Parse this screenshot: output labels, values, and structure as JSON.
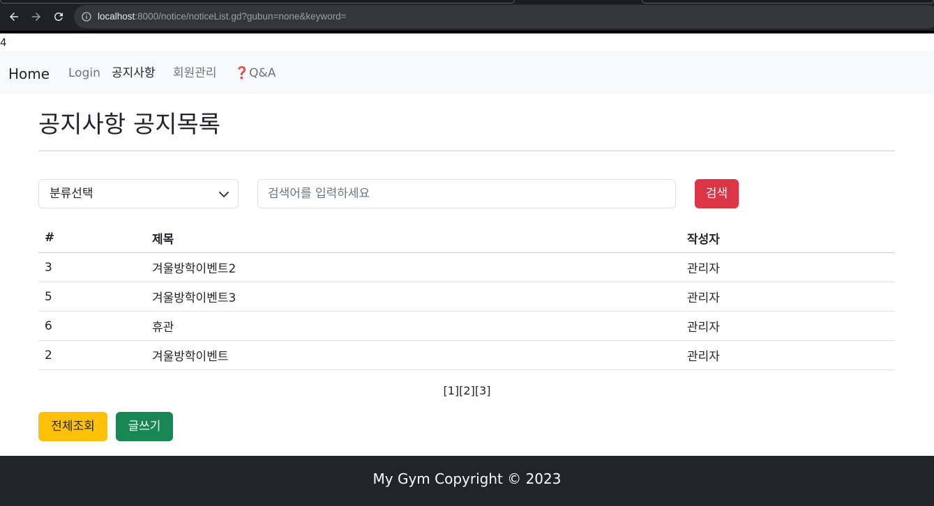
{
  "browser": {
    "url_host": "localhost",
    "url_rest": ":8000/notice/noticeList.gd?gubun=none&keyword=",
    "icons": {
      "back": "arrow-left-icon",
      "forward": "arrow-right-icon",
      "reload": "reload-icon",
      "info": "info-icon"
    }
  },
  "stray_text": "4",
  "navbar": {
    "brand": "Home",
    "links": [
      "Login",
      "공지사항",
      "회원관리",
      "Q&A"
    ],
    "qa_icon": "❓",
    "active": "공지사항"
  },
  "page": {
    "title": "공지사항 공지목록"
  },
  "search": {
    "category_selected": "분류선택",
    "placeholder": "검색어를 입력하세요",
    "keyword_value": "",
    "button": "검색"
  },
  "table": {
    "headers": [
      "#",
      "제목",
      "작성자"
    ],
    "rows": [
      {
        "no": "3",
        "title": "겨울방학이벤트2",
        "writer": "관리자"
      },
      {
        "no": "5",
        "title": "겨울방학이벤트3",
        "writer": "관리자"
      },
      {
        "no": "6",
        "title": "휴관",
        "writer": "관리자"
      },
      {
        "no": "2",
        "title": "겨울방학이벤트",
        "writer": "관리자"
      }
    ]
  },
  "pagination": [
    "[1]",
    "[2]",
    "[3]"
  ],
  "actions": {
    "view_all": "전체조회",
    "write": "글쓰기"
  },
  "footer": {
    "text": "My Gym Copyright © 2023"
  },
  "colors": {
    "danger": "#dc3545",
    "warning": "#ffc107",
    "success": "#198754",
    "footer_bg": "#212529",
    "navbar_bg": "#f8f9fa"
  }
}
